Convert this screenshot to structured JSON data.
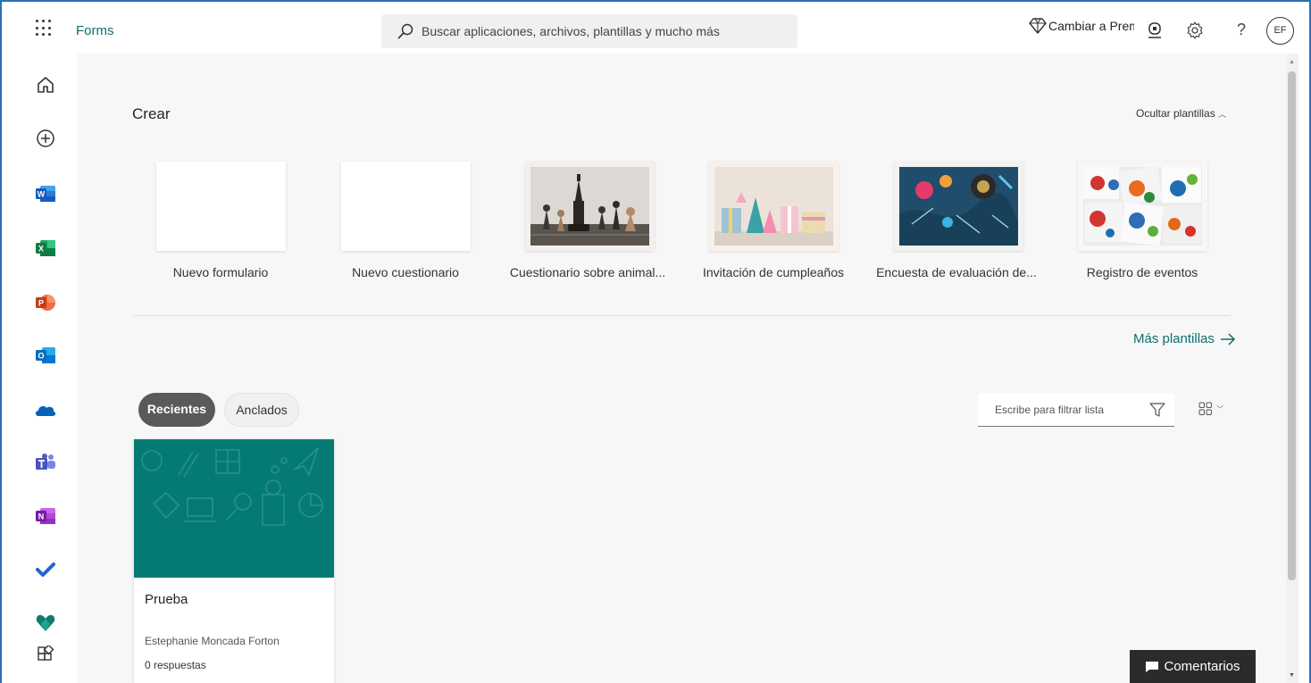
{
  "app": {
    "title": "Forms"
  },
  "search": {
    "placeholder": "Buscar aplicaciones, archivos, plantillas y mucho más"
  },
  "header": {
    "upgrade_label": "Cambiar a Premium",
    "avatar_initials": "EF",
    "help_label": "?"
  },
  "rail": {
    "items": [
      {
        "name": "home-icon"
      },
      {
        "name": "create-icon"
      },
      {
        "name": "word-icon",
        "letter": "W",
        "color": "#185abd"
      },
      {
        "name": "excel-icon",
        "letter": "X",
        "color": "#107c41"
      },
      {
        "name": "powerpoint-icon",
        "letter": "P",
        "color": "#c43e1c"
      },
      {
        "name": "outlook-icon",
        "letter": "O",
        "color": "#0f6cbd"
      },
      {
        "name": "onedrive-icon",
        "color": "#0364b8"
      },
      {
        "name": "teams-icon",
        "color": "#5b5fc7"
      },
      {
        "name": "onenote-icon",
        "letter": "N",
        "color": "#7719aa"
      },
      {
        "name": "todo-icon",
        "color": "#2564cf"
      },
      {
        "name": "viva-icon",
        "color": "#0f7b6c"
      },
      {
        "name": "all-apps-icon"
      }
    ]
  },
  "create": {
    "title": "Crear",
    "hide_templates": "Ocultar plantillas",
    "templates": [
      {
        "label": "Nuevo formulario"
      },
      {
        "label": "Nuevo cuestionario"
      },
      {
        "label": "Cuestionario sobre animal..."
      },
      {
        "label": "Invitación de cumpleaños"
      },
      {
        "label": "Encuesta de evaluación de..."
      },
      {
        "label": "Registro de eventos"
      }
    ],
    "more_templates": "Más plantillas"
  },
  "list": {
    "tabs": [
      {
        "label": "Recientes"
      },
      {
        "label": "Anclados"
      }
    ],
    "filter_placeholder": "Escribe para filtrar lista"
  },
  "forms": [
    {
      "title": "Prueba",
      "owner": "Estephanie Moncada Forton",
      "responses": "0 respuestas",
      "cover_color": "#037b74"
    }
  ],
  "feedback": {
    "label": "Comentarios"
  },
  "colors": {
    "accent": "#0f6e6e",
    "frame": "#2b6fb6"
  }
}
